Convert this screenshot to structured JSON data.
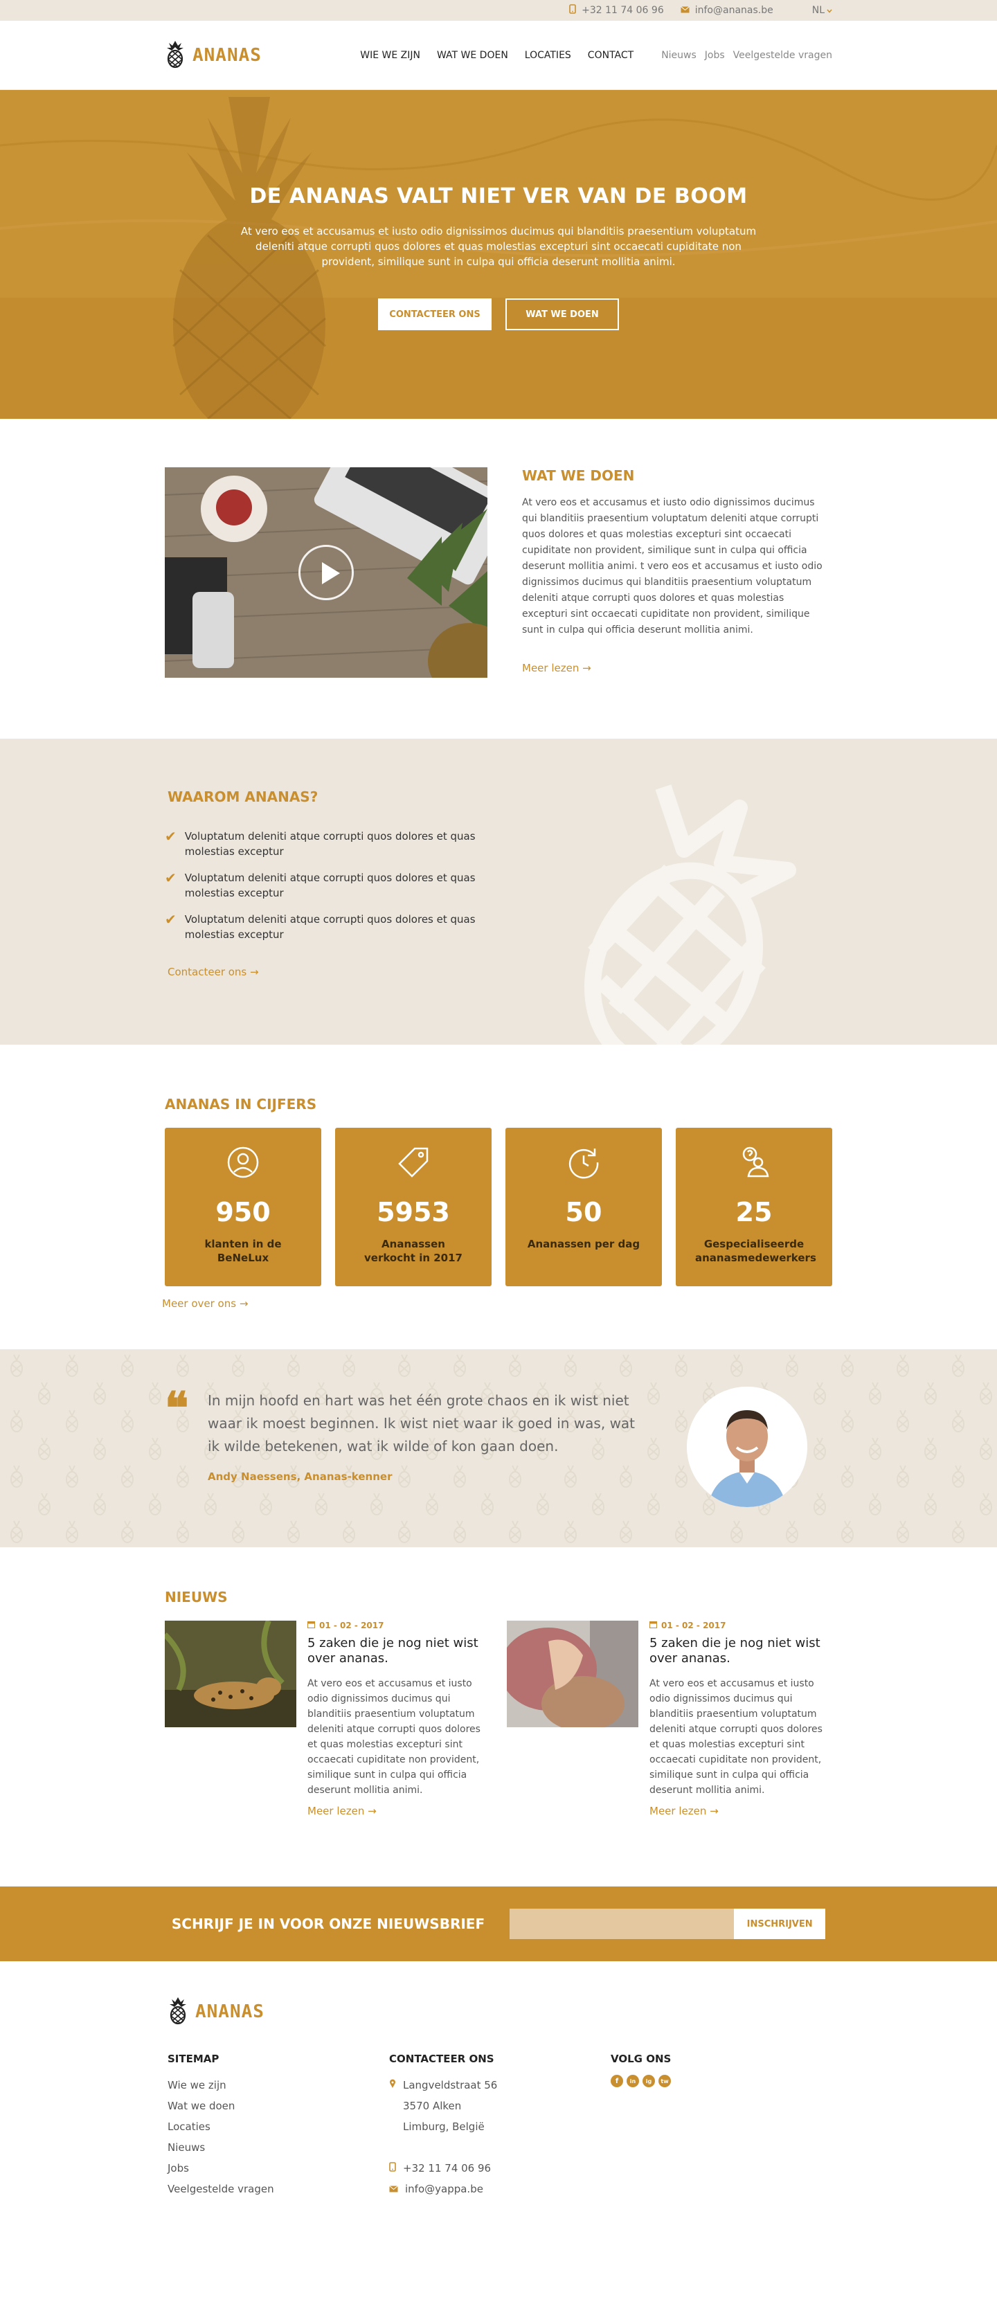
{
  "topbar": {
    "phone": "+32 11 74 06 96",
    "email": "info@ananas.be",
    "lang": "NL"
  },
  "header": {
    "logo": "ANANAS",
    "nav": [
      "WIE WE ZIJN",
      "WAT WE DOEN",
      "LOCATIES",
      "CONTACT"
    ],
    "subnav": [
      "Nieuws",
      "Jobs",
      "Veelgestelde vragen"
    ]
  },
  "hero": {
    "title": "DE ANANAS VALT NIET VER VAN DE BOOM",
    "text": "At vero eos et accusamus et iusto odio dignissimos ducimus qui blanditiis praesentium voluptatum deleniti atque corrupti quos dolores et quas molestias excepturi sint occaecati cupiditate non provident, similique sunt in culpa qui officia deserunt mollitia animi.",
    "btn_primary": "CONTACTEER ONS",
    "btn_secondary": "WAT WE DOEN"
  },
  "wwd": {
    "title": "WAT WE DOEN",
    "text": "At vero eos et accusamus et iusto odio dignissimos ducimus qui blanditiis praesentium voluptatum deleniti atque corrupti quos dolores et quas molestias excepturi sint occaecati cupiditate non provident, similique sunt in culpa qui officia deserunt mollitia animi. t vero eos et accusamus et iusto odio dignissimos ducimus qui blanditiis praesentium voluptatum deleniti atque corrupti quos dolores et quas molestias excepturi sint occaecati cupiditate non provident, similique sunt in culpa qui officia deserunt mollitia animi.",
    "more": "Meer lezen →"
  },
  "waarom": {
    "title": "WAAROM ANANAS?",
    "items": [
      "Voluptatum deleniti atque corrupti quos dolores et quas molestias exceptur",
      "Voluptatum deleniti atque corrupti quos dolores et quas molestias exceptur",
      "Voluptatum deleniti atque corrupti quos dolores et quas molestias exceptur"
    ],
    "more": "Contacteer ons →"
  },
  "cijfers": {
    "title": "ANANAS IN CIJFERS",
    "stats": [
      {
        "value": "950",
        "label": "klanten in de BeNeLux",
        "icon": "user-circle-icon"
      },
      {
        "value": "5953",
        "label": "Ananassen verkocht in 2017",
        "icon": "tag-icon"
      },
      {
        "value": "50",
        "label": "Ananassen per dag",
        "icon": "clock-refresh-icon"
      },
      {
        "value": "25",
        "label": "Gespecialiseerde ananasmedewerkers",
        "icon": "person-question-icon"
      }
    ],
    "more": "Meer over ons →"
  },
  "quote": {
    "text": "In mijn hoofd en hart was het één grote chaos en ik wist niet waar ik moest beginnen. Ik wist niet waar ik goed in was, wat ik wilde betekenen, wat ik wilde of kon gaan doen.",
    "author": "Andy Naessens, Ananas-kenner"
  },
  "nieuws": {
    "title": "NIEUWS",
    "items": [
      {
        "date": "01 - 02 - 2017",
        "title": "5 zaken die je nog niet wist over ananas.",
        "text": "At vero eos et accusamus et iusto odio dignissimos ducimus qui blanditiis praesentium voluptatum deleniti atque corrupti quos dolores et quas molestias excepturi sint occaecati cupiditate non provident, similique sunt in culpa qui officia deserunt mollitia animi.",
        "more": "Meer lezen →"
      },
      {
        "date": "01 - 02 - 2017",
        "title": "5 zaken die je nog niet wist over ananas.",
        "text": "At vero eos et accusamus et iusto odio dignissimos ducimus qui blanditiis praesentium voluptatum deleniti atque corrupti quos dolores et quas molestias excepturi sint occaecati cupiditate non provident, similique sunt in culpa qui officia deserunt mollitia animi.",
        "more": "Meer lezen →"
      }
    ]
  },
  "newsletter": {
    "title": "SCHRIJF JE IN VOOR ONZE NIEUWSBRIEF",
    "placeholder": "",
    "button": "INSCHRIJVEN"
  },
  "footer": {
    "logo": "ANANAS",
    "sitemap_title": "SITEMAP",
    "sitemap": [
      "Wie we zijn",
      "Wat we doen",
      "Locaties",
      "Nieuws",
      "Jobs",
      "Veelgestelde vragen"
    ],
    "contact_title": "CONTACTEER ONS",
    "address": [
      "Langveldstraat 56",
      "3570 Alken",
      "Limburg, België"
    ],
    "phone": "+32 11 74 06 96",
    "email": "info@yappa.be",
    "follow_title": "VOLG ONS",
    "social": [
      "f",
      "in",
      "ig",
      "tw"
    ]
  },
  "colors": {
    "accent": "#C98F2E",
    "sand": "#ECE6DC"
  }
}
